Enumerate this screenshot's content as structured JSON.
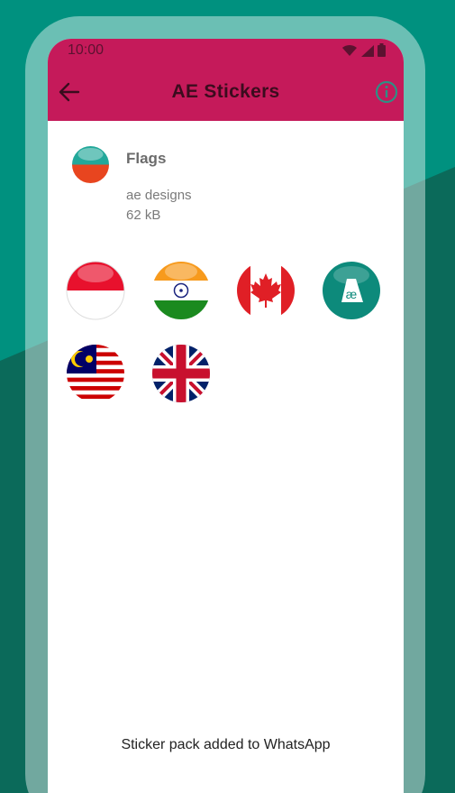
{
  "status_bar": {
    "time": "10:00"
  },
  "app_bar": {
    "title": "AE Stickers",
    "back_icon": "arrow-left-icon",
    "info_icon": "info-icon"
  },
  "pack": {
    "name": "Flags",
    "publisher": "ae designs",
    "size": "62 kB"
  },
  "stickers": [
    {
      "name": "Indonesia flag"
    },
    {
      "name": "India flag"
    },
    {
      "name": "Canada flag"
    },
    {
      "name": "ae logo"
    },
    {
      "name": "Malaysia flag"
    },
    {
      "name": "United Kingdom flag"
    }
  ],
  "footer": {
    "status": "Sticker pack added to WhatsApp"
  },
  "colors": {
    "accent": "#c51a5a",
    "background": "#00917f",
    "background_dark": "#0b6a5a",
    "teal_logo": "#0d8a7b"
  }
}
